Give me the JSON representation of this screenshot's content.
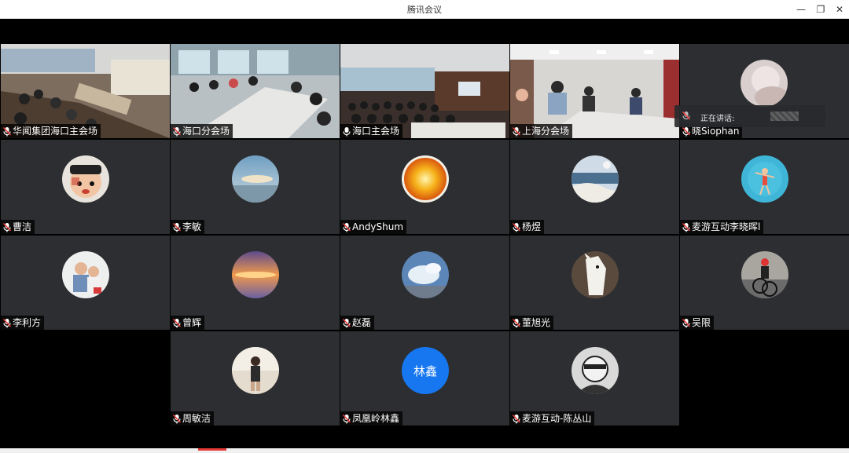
{
  "window": {
    "title": "腾讯会议",
    "minimize_glyph": "—",
    "restore_glyph": "❐",
    "close_glyph": "✕"
  },
  "speaking_tip": {
    "label": "正在讲话:"
  },
  "participants": [
    {
      "name": "华闻集团海口主会场",
      "type": "video",
      "scene": "conference-room-left"
    },
    {
      "name": "海口分会场",
      "type": "video",
      "scene": "meeting-table"
    },
    {
      "name": "海口主会场",
      "type": "video",
      "scene": "audience-hall"
    },
    {
      "name": "上海分会场",
      "type": "video",
      "scene": "office-room"
    },
    {
      "name": "晓Siophan",
      "type": "avatar",
      "avatar": "light-photo-avatar"
    },
    {
      "name": "曹洁",
      "type": "avatar",
      "avatar": "cartoon-avatar"
    },
    {
      "name": "李敏",
      "type": "avatar",
      "avatar": "sky-cloud-avatar"
    },
    {
      "name": "AndyShum",
      "type": "avatar",
      "avatar": "sun-avatar"
    },
    {
      "name": "杨煜",
      "type": "avatar",
      "avatar": "coast-avatar"
    },
    {
      "name": "麦游互动李晓晖l",
      "type": "avatar",
      "avatar": "swimmer-avatar"
    },
    {
      "name": "李利方",
      "type": "avatar",
      "avatar": "family-avatar"
    },
    {
      "name": "曾辉",
      "type": "avatar",
      "avatar": "sunset-avatar"
    },
    {
      "name": "赵磊",
      "type": "avatar",
      "avatar": "blue-cloud-avatar"
    },
    {
      "name": "董旭光",
      "type": "avatar",
      "avatar": "horse-avatar"
    },
    {
      "name": "吴限",
      "type": "avatar",
      "avatar": "cyclist-avatar"
    },
    {
      "name": "周敏洁",
      "type": "avatar",
      "avatar": "portrait-avatar"
    },
    {
      "name": "凤凰岭林鑫",
      "type": "text-avatar",
      "avatar_text": "林鑫",
      "color": "#1677f0"
    },
    {
      "name": "麦游互动-陈丛山",
      "type": "avatar",
      "avatar": "sketch-avatar"
    }
  ],
  "colors": {
    "tile_bg": "#2d2e31",
    "stage_bg": "#000000",
    "mic_muted": "#e53935",
    "name_bg": "#000000"
  }
}
